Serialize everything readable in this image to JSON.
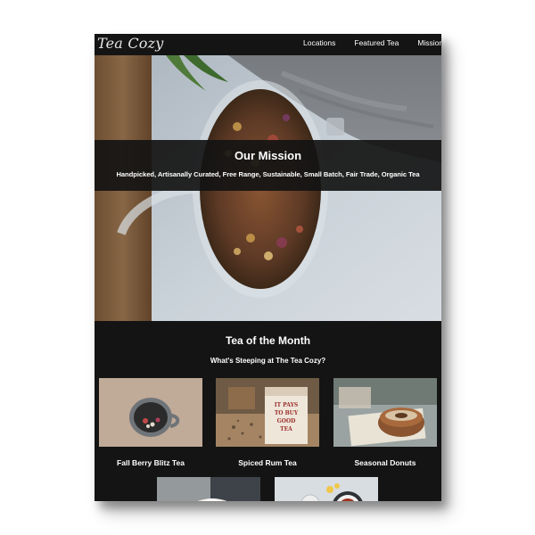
{
  "header": {
    "logo": "Tea Cozy",
    "nav": [
      "Locations",
      "Featured Tea",
      "Mission"
    ]
  },
  "hero": {
    "title": "Our Mission",
    "tags": "Handpicked, Artisanally Curated, Free Range, Sustainable, Small Batch, Fair Trade, Organic Tea"
  },
  "month": {
    "title": "Tea of the Month",
    "subtitle": "What's Steeping at The Tea Cozy?",
    "items": [
      {
        "label": "Fall Berry Blitz Tea"
      },
      {
        "label": "Spiced Rum Tea"
      },
      {
        "label": "Seasonal Donuts"
      },
      {
        "label": ""
      },
      {
        "label": ""
      }
    ],
    "box_text": [
      "IT PAYS",
      "TO BUY",
      "GOOD",
      "TEA"
    ]
  },
  "colors": {
    "background": "#141414",
    "text": "#ffffff"
  }
}
